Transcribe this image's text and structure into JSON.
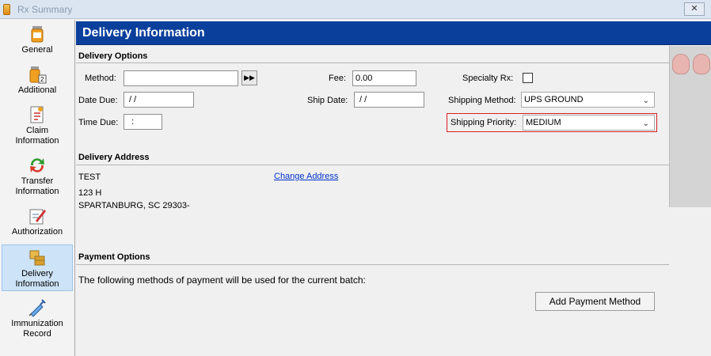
{
  "window": {
    "title": "Rx Summary",
    "close_label": "✕"
  },
  "sidebar": {
    "items": [
      {
        "label": "General"
      },
      {
        "label": "Additional"
      },
      {
        "label": "Claim\nInformation"
      },
      {
        "label": "Transfer\nInformation"
      },
      {
        "label": "Authorization"
      },
      {
        "label": "Delivery\nInformation"
      },
      {
        "label": "Immunization\nRecord"
      }
    ]
  },
  "header": {
    "title": "Delivery Information"
  },
  "delivery_options": {
    "heading": "Delivery Options",
    "method_label": "Method:",
    "method_value": "",
    "method_button": "▶▶",
    "fee_label": "Fee:",
    "fee_value": "0.00",
    "specialty_label": "Specialty Rx:",
    "date_due_label": "Date Due:",
    "date_due_value": " / /",
    "ship_date_label": "Ship Date:",
    "ship_date_value": " / /",
    "shipping_method_label": "Shipping Method:",
    "shipping_method_value": "UPS GROUND",
    "time_due_label": "Time Due:",
    "time_due_value": "  :",
    "shipping_priority_label": "Shipping Priority:",
    "shipping_priority_value": "MEDIUM"
  },
  "delivery_address": {
    "heading": "Delivery Address",
    "line1": "TEST",
    "line2": "123 H",
    "line3": "SPARTANBURG, SC  29303-",
    "change_link": "Change Address"
  },
  "payment_options": {
    "heading": "Payment Options",
    "description": "The following methods of payment will be used for the current batch:",
    "add_button": "Add Payment Method"
  },
  "colors": {
    "header_bg": "#0b3f9c",
    "highlight": "#d92020",
    "link": "#0033cc"
  }
}
